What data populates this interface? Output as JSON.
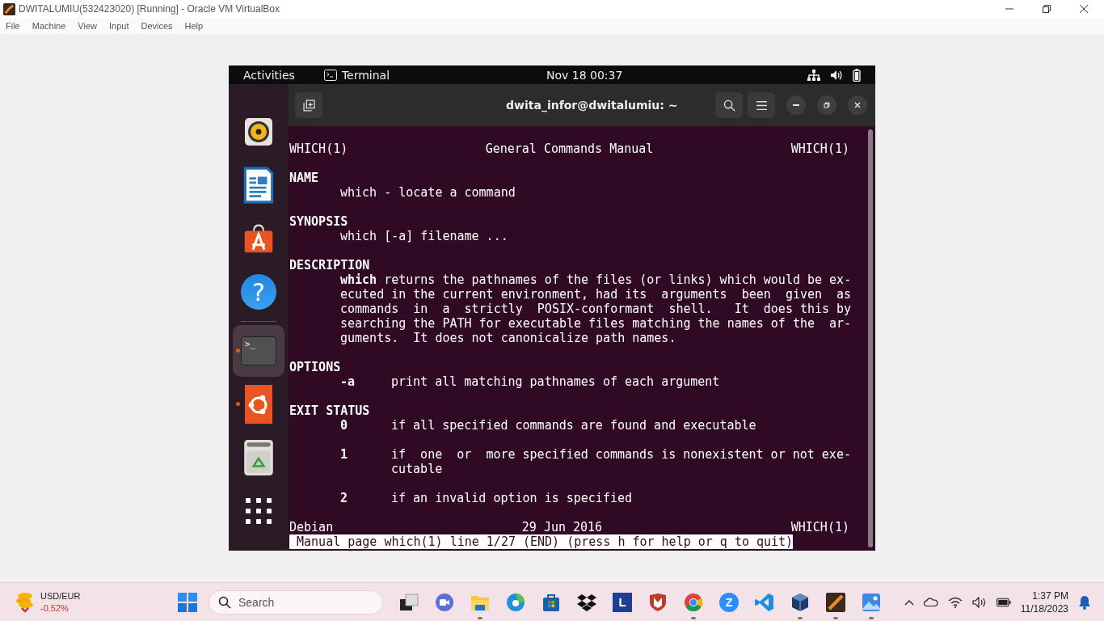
{
  "host_window": {
    "title": "DWITALUMIU(532423020) [Running] - Oracle VM VirtualBox",
    "menu": [
      "File",
      "Machine",
      "View",
      "Input",
      "Devices",
      "Help"
    ]
  },
  "guest": {
    "top_bar": {
      "activities": "Activities",
      "app": "Terminal",
      "clock": "Nov 18  00:37"
    },
    "dock": [
      {
        "kind": "speaker",
        "running": false,
        "selected": false
      },
      {
        "kind": "document",
        "running": false,
        "selected": false
      },
      {
        "kind": "store",
        "running": false,
        "selected": false
      },
      {
        "kind": "help",
        "label": "?",
        "running": false,
        "selected": false
      },
      {
        "kind": "terminal",
        "label": ">_",
        "running": true,
        "selected": true
      },
      {
        "kind": "ubuntu",
        "running": true,
        "selected": false
      },
      {
        "kind": "trash",
        "running": false,
        "selected": false
      },
      {
        "kind": "grid",
        "running": false,
        "selected": false
      }
    ],
    "terminal": {
      "title": "dwita_infor@dwitalumiu: ~",
      "header": {
        "left": "WHICH(1)",
        "center": "General Commands Manual",
        "right": "WHICH(1)"
      },
      "sections": [
        {
          "title": "NAME",
          "items": [
            {
              "kind": "text",
              "lines": [
                "which - locate a command"
              ]
            }
          ]
        },
        {
          "title": "SYNOPSIS",
          "items": [
            {
              "kind": "text",
              "lines": [
                "which [-a] filename ..."
              ]
            }
          ]
        },
        {
          "title": "DESCRIPTION",
          "items": [
            {
              "kind": "text",
              "lines": [
                "**which** returns the pathnames of the files (or links) which would be ex-",
                "ecuted in the current environment, had its  arguments  been  given  as",
                "commands  in  a  strictly  POSIX-conformant  shell.   It  does this by",
                "searching the PATH for executable files matching the names of the  ar-",
                "guments.  It does not canonicalize path names."
              ]
            }
          ]
        },
        {
          "title": "OPTIONS",
          "items": [
            {
              "kind": "entry",
              "term": "-a",
              "lines": [
                "print all matching pathnames of each argument"
              ]
            }
          ]
        },
        {
          "title": "EXIT STATUS",
          "items": [
            {
              "kind": "entry",
              "term": "0",
              "lines": [
                "if all specified commands are found and executable"
              ]
            },
            {
              "kind": "entry",
              "term": "1",
              "lines": [
                "if  one  or  more specified commands is nonexistent or not exe-",
                "cutable"
              ]
            },
            {
              "kind": "entry",
              "term": "2",
              "lines": [
                "if an invalid option is specified"
              ]
            }
          ]
        }
      ],
      "footer": {
        "left": "Debian",
        "center": "29 Jun 2016",
        "right": "WHICH(1)"
      },
      "status": " Manual page which(1) line 1/27 (END) (press h for help or q to quit)"
    }
  },
  "taskbar": {
    "widget": {
      "label": "USD/EUR",
      "change": "-0.52%"
    },
    "search": {
      "placeholder": "Search"
    },
    "apps": [
      {
        "kind": "taskview",
        "running": false
      },
      {
        "kind": "chat",
        "running": false
      },
      {
        "kind": "folder",
        "running": true
      },
      {
        "kind": "edge",
        "running": false
      },
      {
        "kind": "store",
        "running": false
      },
      {
        "kind": "dropbox",
        "running": false
      },
      {
        "kind": "letter",
        "label": "L",
        "running": false
      },
      {
        "kind": "shield",
        "running": false
      },
      {
        "kind": "chrome",
        "running": true
      },
      {
        "kind": "zoom",
        "label": "Z",
        "running": false
      },
      {
        "kind": "code",
        "running": false
      },
      {
        "kind": "cube",
        "running": true
      },
      {
        "kind": "vm",
        "running": true
      },
      {
        "kind": "photos",
        "running": true
      }
    ],
    "tray": {
      "time": "1:37 PM",
      "date": "11/18/2023"
    }
  }
}
